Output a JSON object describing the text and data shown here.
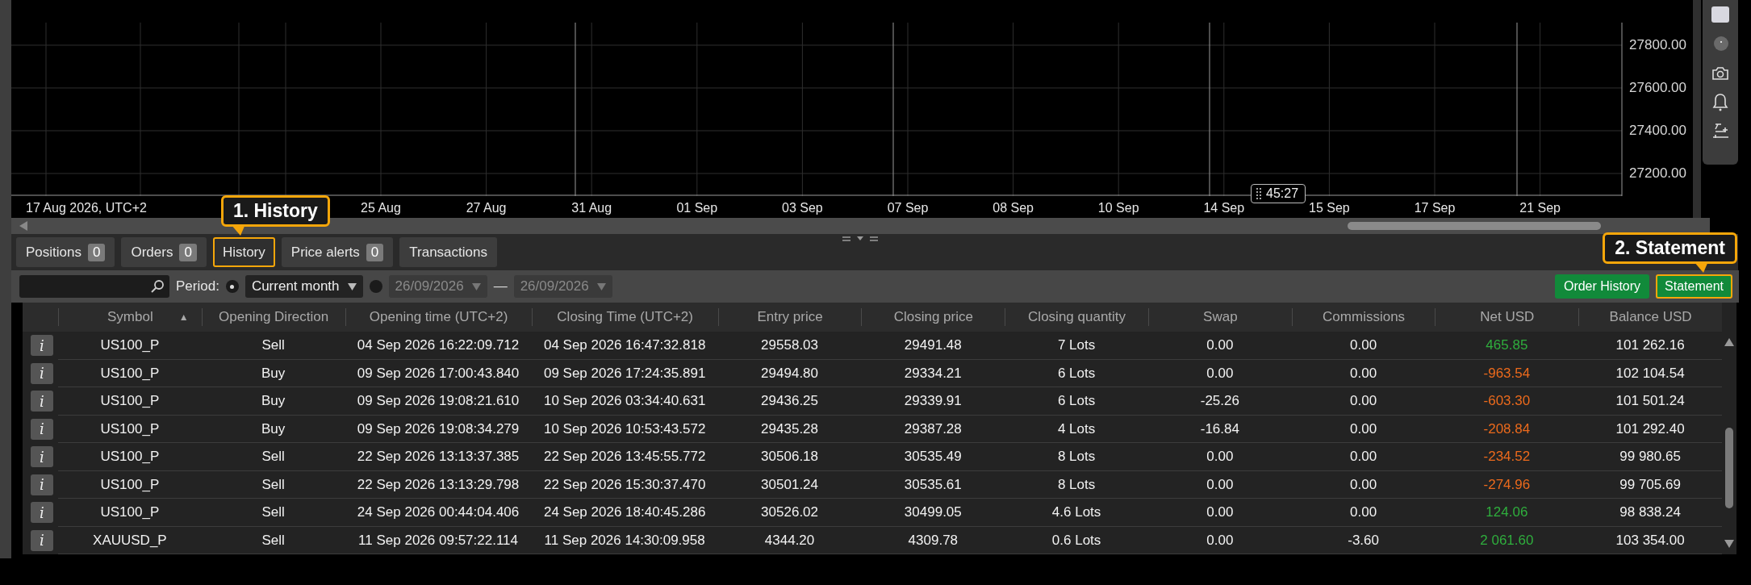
{
  "chart": {
    "y_labels": [
      "27800.00",
      "27600.00",
      "27400.00",
      "27200.00"
    ],
    "x_start_label": "17 Aug 2026, UTC+2",
    "x_labels": [
      "25 Aug",
      "27 Aug",
      "31 Aug",
      "01 Sep",
      "03 Sep",
      "07 Sep",
      "08 Sep",
      "10 Sep",
      "14 Sep",
      "15 Sep",
      "17 Sep",
      "21 Sep"
    ],
    "cursor_time": "45:27"
  },
  "tabs": [
    {
      "label": "Positions",
      "count": "0",
      "selected": false,
      "highlighted": false
    },
    {
      "label": "Orders",
      "count": "0",
      "selected": false,
      "highlighted": false
    },
    {
      "label": "History",
      "selected": true,
      "highlighted": true,
      "callout": "1. History"
    },
    {
      "label": "Price alerts",
      "count": "0",
      "selected": false,
      "highlighted": false
    },
    {
      "label": "Transactions",
      "selected": false,
      "highlighted": false
    }
  ],
  "filters": {
    "period_label": "Period:",
    "options": [
      {
        "kind": "preset",
        "selected": true,
        "value": "Current month"
      },
      {
        "kind": "range",
        "selected": false,
        "disabled": true,
        "from": "26/09/2026",
        "separator": "—",
        "to": "26/09/2026"
      }
    ],
    "buttons": [
      {
        "label": "Order History",
        "highlighted": false
      },
      {
        "label": "Statement",
        "highlighted": true,
        "callout": "2. Statement"
      }
    ]
  },
  "table": {
    "columns": [
      {
        "label": "Symbol",
        "sort": "▲"
      },
      {
        "label": "Opening Direction"
      },
      {
        "label": "Opening time (UTC+2)"
      },
      {
        "label": "Closing Time (UTC+2)"
      },
      {
        "label": "Entry price"
      },
      {
        "label": "Closing price"
      },
      {
        "label": "Closing quantity"
      },
      {
        "label": "Swap"
      },
      {
        "label": "Commissions"
      },
      {
        "label": "Net USD"
      },
      {
        "label": "Balance USD"
      }
    ],
    "rows": [
      {
        "info": "i",
        "cells": [
          "US100_P",
          "Sell",
          "04 Sep 2026 16:22:09.712",
          "04 Sep 2026 16:47:32.818",
          "29558.03",
          "29491.48",
          "7 Lots",
          "0.00",
          "0.00",
          "465.85",
          "101 262.16"
        ],
        "color": "#2fae3d"
      },
      {
        "info": "i",
        "cells": [
          "US100_P",
          "Buy",
          "09 Sep 2026 17:00:43.840",
          "09 Sep 2026 17:24:35.891",
          "29494.80",
          "29334.21",
          "6 Lots",
          "0.00",
          "0.00",
          "-963.54",
          "102 104.54"
        ],
        "color": "#ec6a1c"
      },
      {
        "info": "i",
        "cells": [
          "US100_P",
          "Buy",
          "09 Sep 2026 19:08:21.610",
          "10 Sep 2026 03:34:40.631",
          "29436.25",
          "29339.91",
          "6 Lots",
          "-25.26",
          "0.00",
          "-603.30",
          "101 501.24"
        ],
        "color": "#ec6a1c"
      },
      {
        "info": "i",
        "cells": [
          "US100_P",
          "Buy",
          "09 Sep 2026 19:08:34.279",
          "10 Sep 2026 10:53:43.572",
          "29435.28",
          "29387.28",
          "4 Lots",
          "-16.84",
          "0.00",
          "-208.84",
          "101 292.40"
        ],
        "color": "#ec6a1c"
      },
      {
        "info": "i",
        "cells": [
          "US100_P",
          "Sell",
          "22 Sep 2026 13:13:37.385",
          "22 Sep 2026 13:45:55.772",
          "30506.18",
          "30535.49",
          "8 Lots",
          "0.00",
          "0.00",
          "-234.52",
          "99 980.65"
        ],
        "color": "#ec6a1c"
      },
      {
        "info": "i",
        "cells": [
          "US100_P",
          "Sell",
          "22 Sep 2026 13:13:29.798",
          "22 Sep 2026 15:30:37.470",
          "30501.24",
          "30535.61",
          "8 Lots",
          "0.00",
          "0.00",
          "-274.96",
          "99 705.69"
        ],
        "color": "#ec6a1c"
      },
      {
        "info": "i",
        "cells": [
          "US100_P",
          "Sell",
          "24 Sep 2026 00:44:04.406",
          "24 Sep 2026 18:40:45.286",
          "30526.02",
          "30499.05",
          "4.6 Lots",
          "0.00",
          "0.00",
          "124.06",
          "98 838.24"
        ],
        "color": "#2fae3d"
      },
      {
        "info": "i",
        "cells": [
          "XAUUSD_P",
          "Sell",
          "11 Sep 2026 09:57:22.114",
          "11 Sep 2026 14:30:09.958",
          "4344.20",
          "4309.78",
          "0.6 Lots",
          "0.00",
          "-3.60",
          "2 061.60",
          "103 354.00"
        ],
        "color": "#2fae3d"
      }
    ]
  }
}
